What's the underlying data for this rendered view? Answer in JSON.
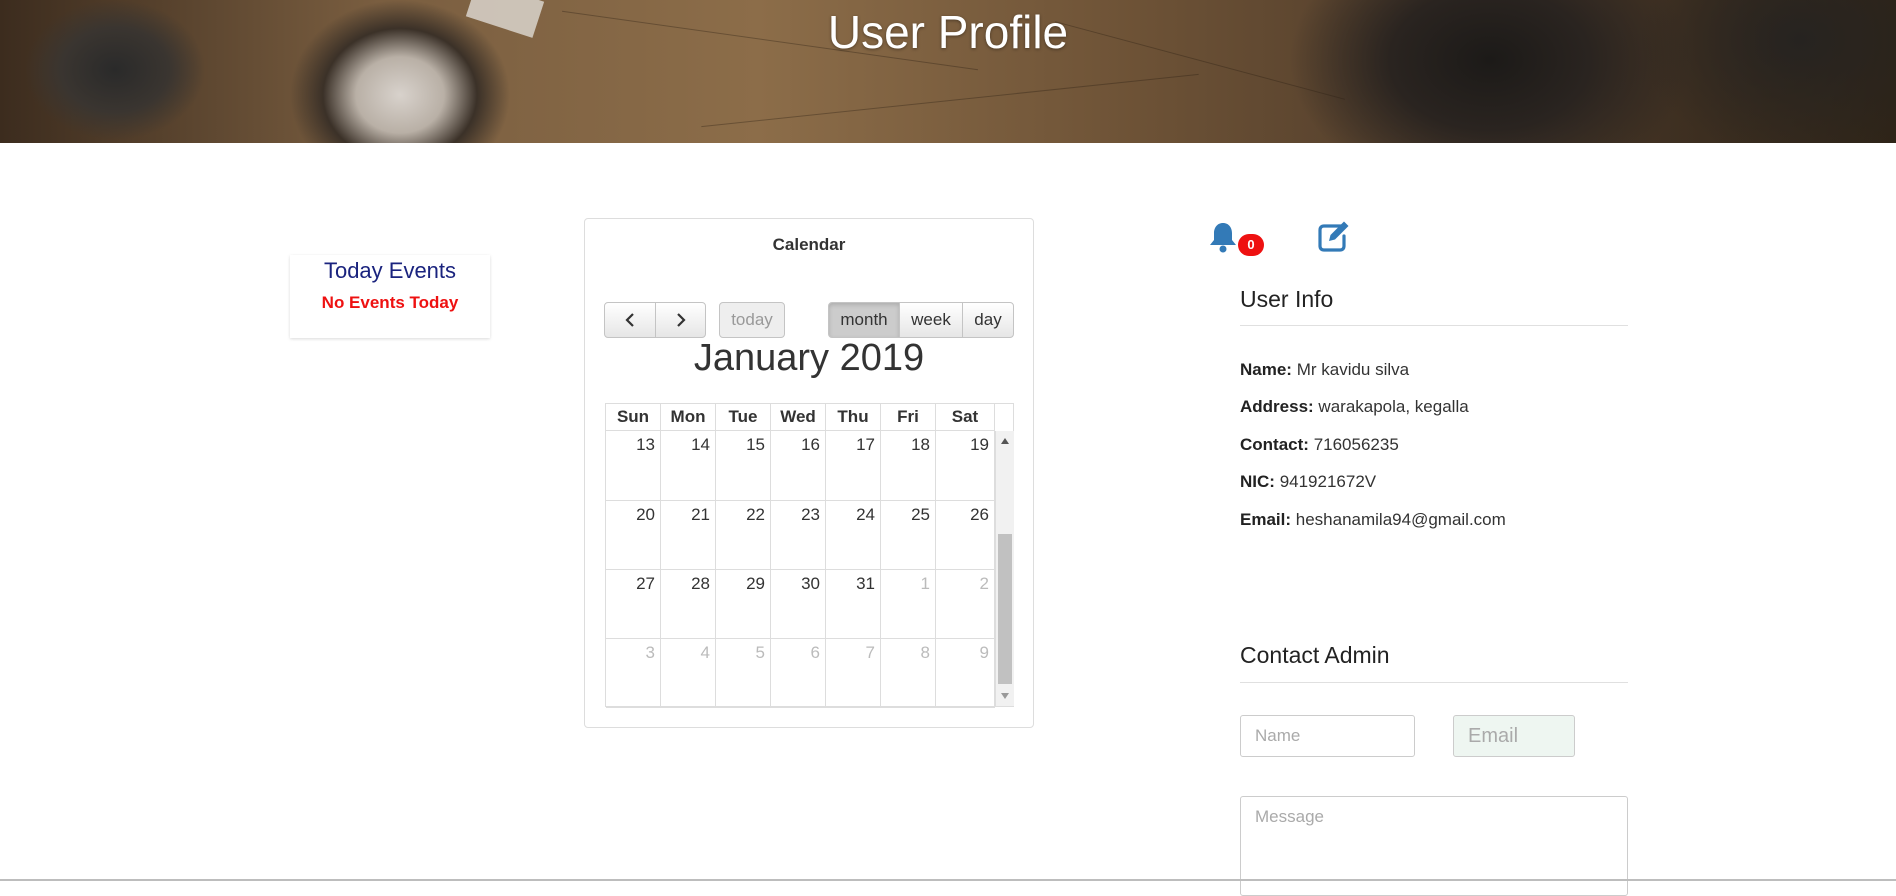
{
  "header": {
    "title": "User Profile"
  },
  "today_events": {
    "title": "Today Events",
    "empty_text": "No Events Today"
  },
  "calendar": {
    "heading": "Calendar",
    "buttons": {
      "prev": "<",
      "next": ">",
      "today": "today",
      "month": "month",
      "week": "week",
      "day": "day"
    },
    "active_view": "month",
    "title": "January 2019",
    "weekdays": [
      "Sun",
      "Mon",
      "Tue",
      "Wed",
      "Thu",
      "Fri",
      "Sat"
    ],
    "weeks": [
      [
        {
          "d": "13"
        },
        {
          "d": "14"
        },
        {
          "d": "15"
        },
        {
          "d": "16"
        },
        {
          "d": "17"
        },
        {
          "d": "18"
        },
        {
          "d": "19"
        }
      ],
      [
        {
          "d": "20"
        },
        {
          "d": "21"
        },
        {
          "d": "22"
        },
        {
          "d": "23"
        },
        {
          "d": "24"
        },
        {
          "d": "25"
        },
        {
          "d": "26"
        }
      ],
      [
        {
          "d": "27"
        },
        {
          "d": "28"
        },
        {
          "d": "29"
        },
        {
          "d": "30"
        },
        {
          "d": "31"
        },
        {
          "d": "1",
          "other": true
        },
        {
          "d": "2",
          "other": true
        }
      ],
      [
        {
          "d": "3",
          "other": true
        },
        {
          "d": "4",
          "other": true
        },
        {
          "d": "5",
          "other": true
        },
        {
          "d": "6",
          "other": true
        },
        {
          "d": "7",
          "other": true
        },
        {
          "d": "8",
          "other": true
        },
        {
          "d": "9",
          "other": true
        }
      ]
    ]
  },
  "notifications": {
    "count": "0",
    "icon": "bell-icon"
  },
  "edit": {
    "icon": "edit-icon"
  },
  "user_info": {
    "title": "User Info",
    "fields": [
      {
        "label": "Name:",
        "value": "Mr kavidu silva"
      },
      {
        "label": "Address:",
        "value": "warakapola, kegalla"
      },
      {
        "label": "Contact:",
        "value": "716056235"
      },
      {
        "label": "NIC:",
        "value": "941921672V"
      },
      {
        "label": "Email:",
        "value": "heshanamila94@gmail.com"
      }
    ]
  },
  "contact_admin": {
    "title": "Contact Admin",
    "name_placeholder": "Name",
    "email_placeholder": "Email",
    "message_placeholder": "Message"
  },
  "colors": {
    "accent": "#337ab7",
    "badge": "#ee1111",
    "today_title": "#1a237e"
  }
}
